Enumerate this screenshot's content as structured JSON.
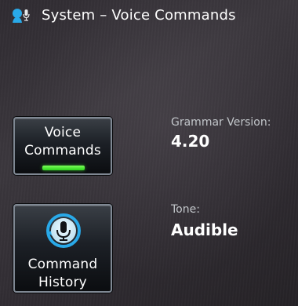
{
  "header": {
    "title": "System – Voice Commands",
    "icon": "voice-profile-icon"
  },
  "tiles": [
    {
      "label_lines": [
        "Voice",
        "Commands"
      ],
      "active": true,
      "indicator_color": "#3be32a"
    },
    {
      "label_lines": [
        "Command",
        "History"
      ],
      "icon": "microphone-history-icon"
    }
  ],
  "info": {
    "grammar_version": {
      "label": "Grammar Version:",
      "value": "4.20"
    },
    "tone": {
      "label": "Tone:",
      "value": "Audible"
    }
  },
  "colors": {
    "accent_blue": "#29a9e8",
    "active_green": "#3be32a",
    "tile_border": "#7f8893"
  }
}
